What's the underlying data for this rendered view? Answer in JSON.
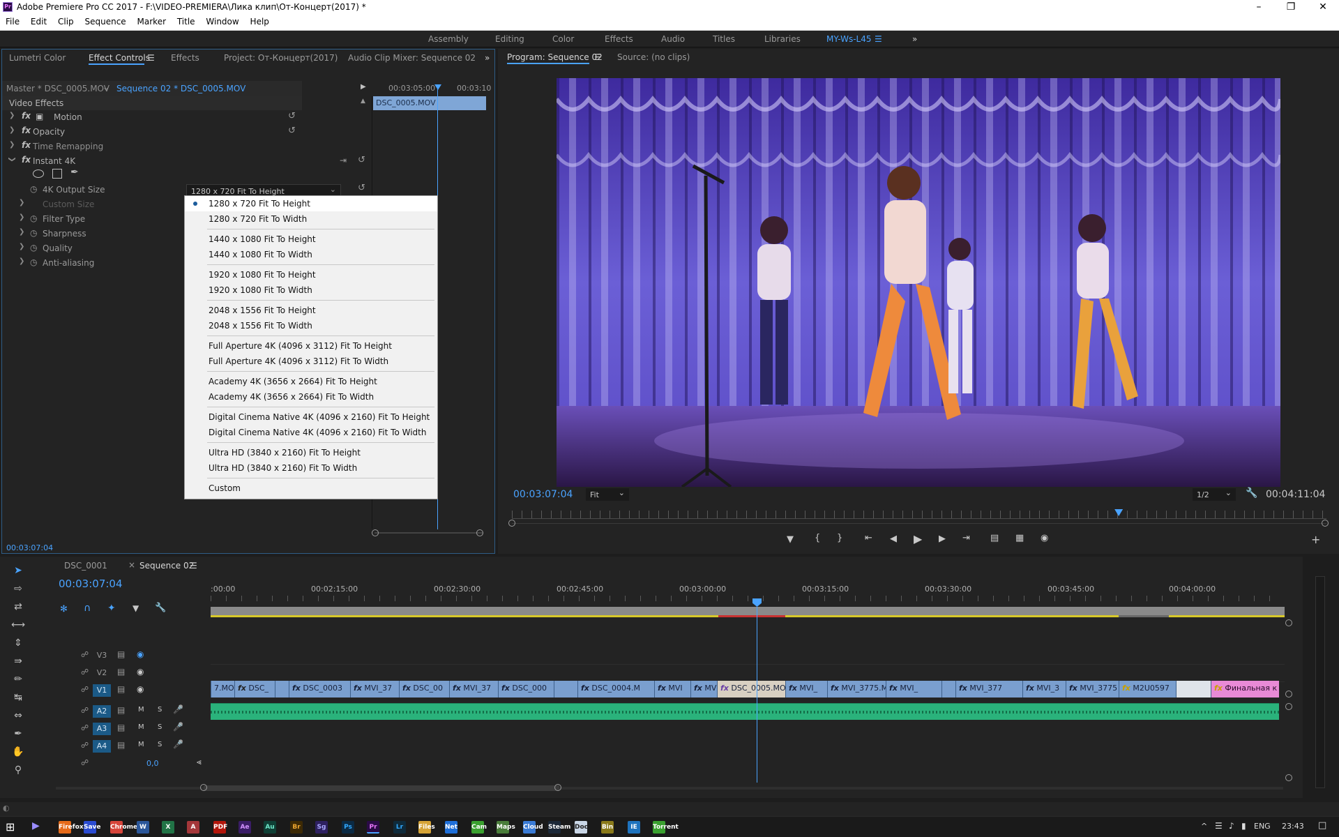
{
  "window": {
    "title": "Adobe Premiere Pro CC 2017 - F:\\VIDEO-PREMIERA\\Лика клип\\От-Концерт(2017) *",
    "app_icon": "Pr"
  },
  "menu": [
    "File",
    "Edit",
    "Clip",
    "Sequence",
    "Marker",
    "Title",
    "Window",
    "Help"
  ],
  "workspaces": [
    "Assembly",
    "Editing",
    "Color",
    "Effects",
    "Audio",
    "Titles",
    "Libraries",
    "MY-Ws-L45"
  ],
  "left_panel": {
    "tabs": [
      "Lumetri Color",
      "Effect Controls",
      "Effects",
      "Project: От-Концерт(2017)",
      "Audio Clip Mixer: Sequence 02"
    ],
    "master_label": "Master * DSC_0005.MOV",
    "sequence_label": "Sequence 02 * DSC_0005.MOV",
    "timeline_times": [
      "00:03:05:00",
      "00:03:10"
    ],
    "clip_name": "DSC_0005.MOV",
    "section": "Video Effects",
    "effects": [
      {
        "name": "Motion"
      },
      {
        "name": "Opacity"
      },
      {
        "name": "Time Remapping"
      },
      {
        "name": "Instant 4K"
      }
    ],
    "params": [
      "4K Output Size",
      "Custom Size",
      "Filter Type",
      "Sharpness",
      "Quality",
      "Anti-aliasing"
    ],
    "output_size_value": "1280 x 720 Fit To Height",
    "timecode": "00:03:07:04"
  },
  "dropdown": {
    "groups": [
      [
        "1280 x 720 Fit To Height",
        "1280 x 720 Fit To Width"
      ],
      [
        "1440 x 1080 Fit To Height",
        "1440 x 1080 Fit To Width"
      ],
      [
        "1920 x 1080 Fit To Height",
        "1920 x 1080 Fit To Width"
      ],
      [
        "2048 x 1556 Fit To Height",
        "2048 x 1556 Fit To Width"
      ],
      [
        "Full Aperture 4K (4096 x 3112) Fit To Height",
        "Full Aperture 4K (4096 x 3112) Fit To Width"
      ],
      [
        "Academy 4K (3656 x 2664) Fit To Height",
        "Academy 4K (3656 x 2664) Fit To Width"
      ],
      [
        "Digital Cinema Native 4K (4096 x 2160) Fit To Height",
        "Digital Cinema Native 4K (4096 x 2160) Fit To Width"
      ],
      [
        "Ultra HD (3840 x 2160) Fit To Height",
        "Ultra HD (3840 x 2160) Fit To Width"
      ],
      [
        "Custom"
      ]
    ],
    "selected": "1280 x 720 Fit To Height"
  },
  "program": {
    "tab": "Program: Sequence 02",
    "source_tab": "Source: (no clips)",
    "timecode": "00:03:07:04",
    "fit": "Fit",
    "resolution": "1/2",
    "duration": "00:04:11:04",
    "playhead_fraction": 0.745
  },
  "timeline": {
    "tabs": [
      "DSC_0001",
      "Sequence 02"
    ],
    "timecode": "00:03:07:04",
    "ruler": [
      ":00:00",
      "00:02:15:00",
      "00:02:30:00",
      "00:02:45:00",
      "00:03:00:00",
      "00:03:15:00",
      "00:03:30:00",
      "00:03:45:00",
      "00:04:00:00"
    ],
    "video_tracks": [
      "V3",
      "V2",
      "V1"
    ],
    "audio_tracks": [
      "A2",
      "A3",
      "A4"
    ],
    "track_m": "M",
    "track_s": "S",
    "master_value": "0,0",
    "clips": [
      {
        "name": "7.MOV"
      },
      {
        "name": "DSC_"
      },
      {
        "name": "DSC_0003"
      },
      {
        "name": "MVI_37"
      },
      {
        "name": "DSC_00"
      },
      {
        "name": "MVI_37"
      },
      {
        "name": "DSC_000"
      },
      {
        "name": "DSC_0004.M"
      },
      {
        "name": "MVI"
      },
      {
        "name": "MVI"
      },
      {
        "name": "DSC_0005.MO"
      },
      {
        "name": "MVI_"
      },
      {
        "name": "MVI_3775.M"
      },
      {
        "name": "MVI_"
      },
      {
        "name": "MVI_377"
      },
      {
        "name": "MVI_3"
      },
      {
        "name": "MVI_3775"
      },
      {
        "name": "M2U0597"
      },
      {
        "name": "Финальная к"
      }
    ]
  },
  "taskbar": {
    "language": "ENG",
    "clock": "23:43",
    "apps": [
      "Firefox",
      "Save",
      "Chrome",
      "W",
      "X",
      "A",
      "PDF",
      "Ae",
      "Au",
      "Br",
      "Sg",
      "Ps",
      "Pr",
      "Lr",
      "Files",
      "Net",
      "Cam",
      "Maps",
      "Cloud",
      "Steam",
      "Doc",
      "Bin",
      "IE",
      "Torrent"
    ]
  },
  "colors": {
    "accent": "#4aa3ff",
    "audio_waveform": "#2ab27b",
    "video_clip": "#7a9fcf",
    "selected_clip": "#d8d0c2",
    "adjust_clip": "#e88ad6"
  }
}
